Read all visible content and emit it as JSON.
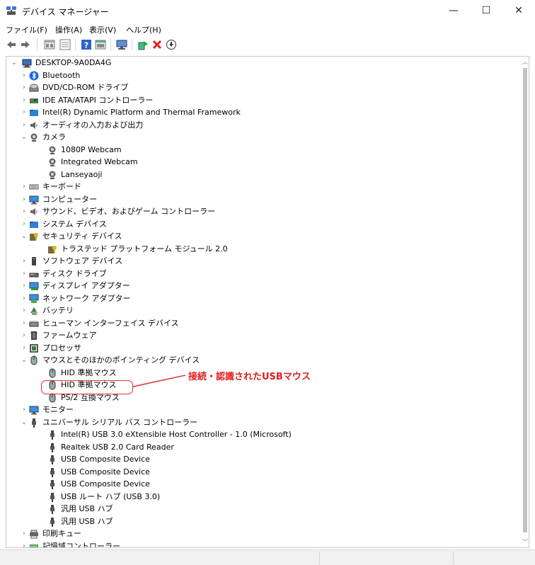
{
  "window": {
    "title": "デバイス マネージャー",
    "controls": {
      "minimize": "—",
      "maximize": "☐",
      "close": "✕"
    }
  },
  "menu": [
    "ファイル(F)",
    "操作(A)",
    "表示(V)",
    "ヘルプ(H)"
  ],
  "toolbar": [
    "back-icon",
    "forward-icon",
    "properties-icon",
    "view-icon",
    "help-icon",
    "view2-icon",
    "monitor-scan-icon",
    "update-driver-icon",
    "uninstall-icon",
    "download-icon"
  ],
  "tree": [
    {
      "label": "DESKTOP-9A0DA4G",
      "level": 0,
      "chevron": "down",
      "icon": "computer-icon"
    },
    {
      "label": "Bluetooth",
      "level": 1,
      "chevron": "right",
      "icon": "bluetooth-icon"
    },
    {
      "label": "DVD/CD-ROM ドライブ",
      "level": 1,
      "chevron": "right",
      "icon": "dvd-icon"
    },
    {
      "label": "IDE ATA/ATAPI コントローラー",
      "level": 1,
      "chevron": "right",
      "icon": "ide-icon"
    },
    {
      "label": "Intel(R) Dynamic Platform and Thermal Framework",
      "level": 1,
      "chevron": "right",
      "icon": "folder-icon"
    },
    {
      "label": "オーディオの入力および出力",
      "level": 1,
      "chevron": "right",
      "icon": "audio-icon"
    },
    {
      "label": "カメラ",
      "level": 1,
      "chevron": "down",
      "icon": "camera-icon"
    },
    {
      "label": "1080P Webcam",
      "level": 2,
      "chevron": "",
      "icon": "camera-icon"
    },
    {
      "label": "Integrated Webcam",
      "level": 2,
      "chevron": "",
      "icon": "camera-icon"
    },
    {
      "label": "Lanseyaoji",
      "level": 2,
      "chevron": "",
      "icon": "camera-icon"
    },
    {
      "label": "キーボード",
      "level": 1,
      "chevron": "right",
      "icon": "keyboard-icon"
    },
    {
      "label": "コンピューター",
      "level": 1,
      "chevron": "right",
      "icon": "monitor-icon"
    },
    {
      "label": "サウンド、ビデオ、およびゲーム コントローラー",
      "level": 1,
      "chevron": "right",
      "icon": "audio-icon"
    },
    {
      "label": "システム デバイス",
      "level": 1,
      "chevron": "right",
      "icon": "folder-icon"
    },
    {
      "label": "セキュリティ デバイス",
      "level": 1,
      "chevron": "down",
      "icon": "security-icon"
    },
    {
      "label": "トラステッド プラットフォーム モジュール 2.0",
      "level": 2,
      "chevron": "",
      "icon": "security-icon"
    },
    {
      "label": "ソフトウェア デバイス",
      "level": 1,
      "chevron": "right",
      "icon": "software-icon"
    },
    {
      "label": "ディスク ドライブ",
      "level": 1,
      "chevron": "right",
      "icon": "disk-icon"
    },
    {
      "label": "ディスプレイ アダプター",
      "level": 1,
      "chevron": "right",
      "icon": "display-icon"
    },
    {
      "label": "ネットワーク アダプター",
      "level": 1,
      "chevron": "right",
      "icon": "network-icon"
    },
    {
      "label": "バッテリ",
      "level": 1,
      "chevron": "right",
      "icon": "battery-icon"
    },
    {
      "label": "ヒューマン インターフェイス デバイス",
      "level": 1,
      "chevron": "right",
      "icon": "hid-icon"
    },
    {
      "label": "ファームウェア",
      "level": 1,
      "chevron": "right",
      "icon": "firmware-icon"
    },
    {
      "label": "プロセッサ",
      "level": 1,
      "chevron": "right",
      "icon": "processor-icon"
    },
    {
      "label": "マウスとそのほかのポインティング デバイス",
      "level": 1,
      "chevron": "down",
      "icon": "mouse-icon"
    },
    {
      "label": "HID 準拠マウス",
      "level": 2,
      "chevron": "",
      "icon": "mouse-icon"
    },
    {
      "label": "HID 準拠マウス",
      "level": 2,
      "chevron": "",
      "icon": "mouse-icon",
      "highlight": true
    },
    {
      "label": "PS/2 互換マウス",
      "level": 2,
      "chevron": "",
      "icon": "mouse-icon"
    },
    {
      "label": "モニター",
      "level": 1,
      "chevron": "right",
      "icon": "monitor-icon"
    },
    {
      "label": "ユニバーサル シリアル バス コントローラー",
      "level": 1,
      "chevron": "down",
      "icon": "usb-icon"
    },
    {
      "label": "Intel(R) USB 3.0 eXtensible Host Controller - 1.0 (Microsoft)",
      "level": 2,
      "chevron": "",
      "icon": "usb-icon"
    },
    {
      "label": "Realtek USB 2.0 Card Reader",
      "level": 2,
      "chevron": "",
      "icon": "usb-icon"
    },
    {
      "label": "USB Composite Device",
      "level": 2,
      "chevron": "",
      "icon": "usb-icon"
    },
    {
      "label": "USB Composite Device",
      "level": 2,
      "chevron": "",
      "icon": "usb-icon"
    },
    {
      "label": "USB Composite Device",
      "level": 2,
      "chevron": "",
      "icon": "usb-icon"
    },
    {
      "label": "USB ルート ハブ (USB 3.0)",
      "level": 2,
      "chevron": "",
      "icon": "usb-icon"
    },
    {
      "label": "汎用 USB ハブ",
      "level": 2,
      "chevron": "",
      "icon": "usb-icon"
    },
    {
      "label": "汎用 USB ハブ",
      "level": 2,
      "chevron": "",
      "icon": "usb-icon"
    },
    {
      "label": "印刷キュー",
      "level": 1,
      "chevron": "right",
      "icon": "printer-icon"
    },
    {
      "label": "記憶域コントローラー",
      "level": 1,
      "chevron": "right",
      "icon": "storage-icon"
    }
  ],
  "annotation": {
    "text": "接続・認識されたUSBマウス",
    "color": "#e02020"
  }
}
